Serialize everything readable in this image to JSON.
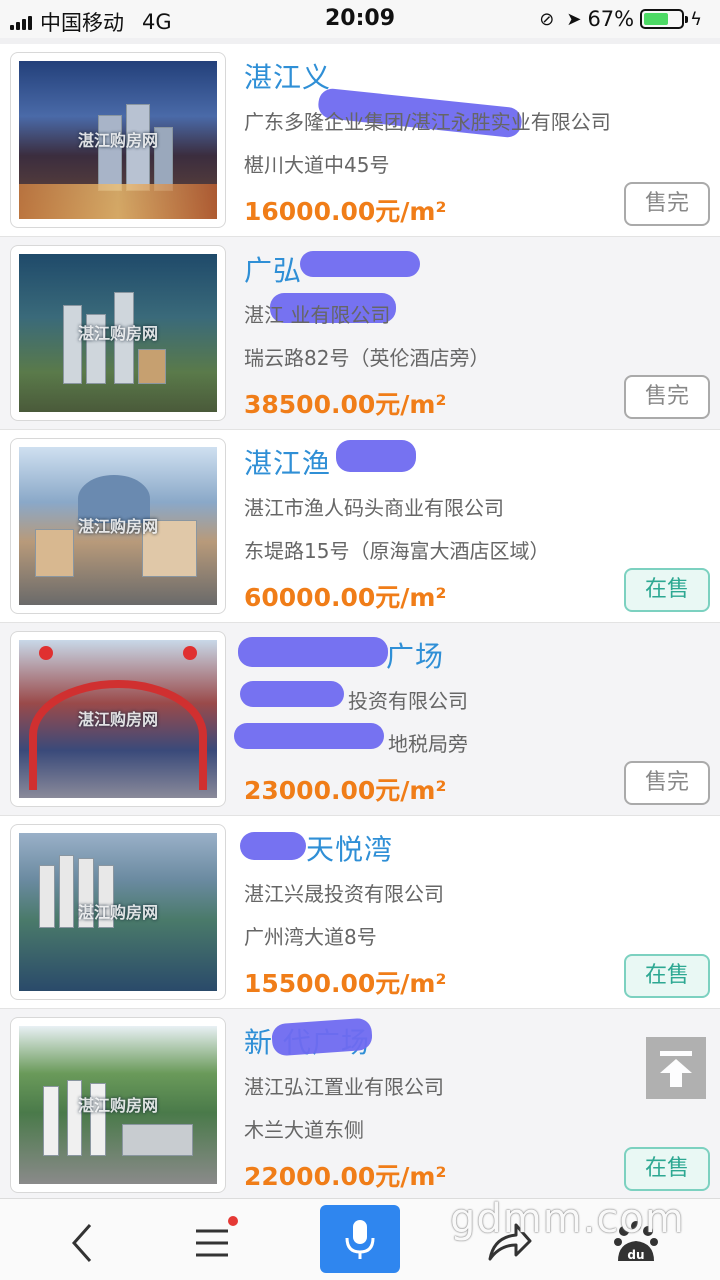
{
  "status_bar": {
    "carrier": "中国移动",
    "network": "4G",
    "time": "20:09",
    "battery": "67%",
    "battery_level": 0.67
  },
  "listings": [
    {
      "name": "湛江义",
      "company": "广东多隆企业集团/湛江永胜实业有限公司",
      "address": "椹川大道中45号",
      "price": "16000.00元/m²",
      "status": "售完",
      "status_type": "sold",
      "image_watermark": "湛江购房网"
    },
    {
      "name": "广弘",
      "company": "湛江 业有限公司",
      "address": "瑞云路82号（英伦酒店旁）",
      "price": "38500.00元/m²",
      "status": "售完",
      "status_type": "sold",
      "image_watermark": "湛江购房网"
    },
    {
      "name": "湛江渔",
      "company": "湛江市渔人码头商业有限公司",
      "address": "东堤路15号（原海富大酒店区域）",
      "price": "60000.00元/m²",
      "status": "在售",
      "status_type": "sale",
      "image_watermark": "湛江购房网"
    },
    {
      "name": "广场",
      "company": "投资有限公司",
      "address": "地税局旁",
      "price": "23000.00元/m²",
      "status": "售完",
      "status_type": "sold",
      "image_watermark": "湛江购房网"
    },
    {
      "name": "天悦湾",
      "company": "湛江兴晟投资有限公司",
      "address": "广州湾大道8号",
      "price": "15500.00元/m²",
      "status": "在售",
      "status_type": "sale",
      "image_watermark": "湛江购房网"
    },
    {
      "name": "新 代广场",
      "company": "湛江弘江置业有限公司",
      "address": "木兰大道东侧",
      "price": "22000.00元/m²",
      "status": "在售",
      "status_type": "sale",
      "image_watermark": "湛江购房网"
    }
  ],
  "bottom_nav": {
    "items": [
      "back-icon",
      "menu-icon",
      "microphone-icon",
      "share-icon",
      "baidu-icon"
    ],
    "baidu_label": "du"
  },
  "watermark": "gdmm.com",
  "colors": {
    "title_blue": "#2f8fd6",
    "price_orange": "#f07d18",
    "sale_green": "#2da892",
    "mic_blue": "#2f86ef"
  }
}
